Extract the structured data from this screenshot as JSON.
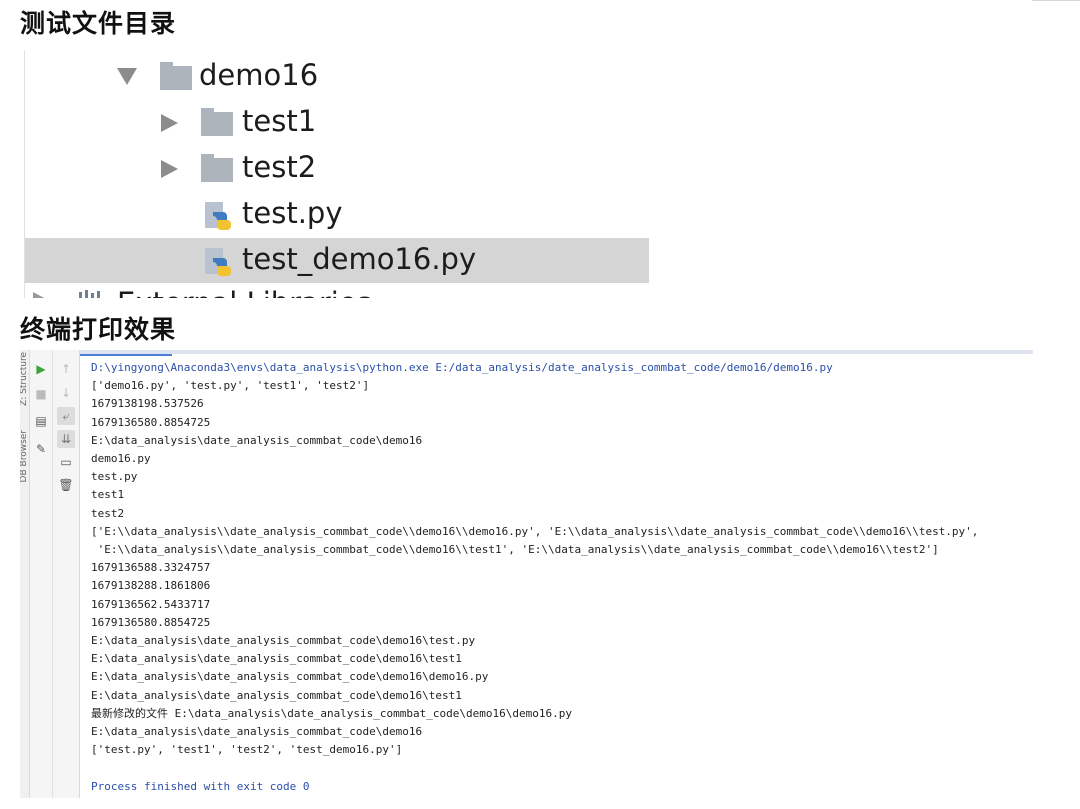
{
  "heading_tree": "测试文件目录",
  "heading_console": "终端打印效果",
  "tree": {
    "items": [
      {
        "label": "demo16",
        "kind": "folder",
        "arrow": "down"
      },
      {
        "label": "test1",
        "kind": "folder",
        "arrow": "right"
      },
      {
        "label": "test2",
        "kind": "folder",
        "arrow": "right"
      },
      {
        "label": "test.py",
        "kind": "python-file",
        "arrow": ""
      },
      {
        "label": "test_demo16.py",
        "kind": "python-file",
        "arrow": "",
        "selected": true
      }
    ],
    "cut_item": "External Libraries"
  },
  "console": {
    "side_tabs": [
      "Z: Structure",
      "DB Browser"
    ],
    "lines": [
      "D:\\yingyong\\Anaconda3\\envs\\data_analysis\\python.exe E:/data_analysis/date_analysis_commbat_code/demo16/demo16.py",
      "['demo16.py', 'test.py', 'test1', 'test2']",
      "1679138198.537526",
      "1679136580.8854725",
      "E:\\data_analysis\\date_analysis_commbat_code\\demo16",
      "demo16.py",
      "test.py",
      "test1",
      "test2",
      "['E:\\\\data_analysis\\\\date_analysis_commbat_code\\\\demo16\\\\demo16.py', 'E:\\\\data_analysis\\\\date_analysis_commbat_code\\\\demo16\\\\test.py',",
      " 'E:\\\\data_analysis\\\\date_analysis_commbat_code\\\\demo16\\\\test1', 'E:\\\\data_analysis\\\\date_analysis_commbat_code\\\\demo16\\\\test2']",
      "1679136588.3324757",
      "1679138288.1861806",
      "1679136562.5433717",
      "1679136580.8854725",
      "E:\\data_analysis\\date_analysis_commbat_code\\demo16\\test.py",
      "E:\\data_analysis\\date_analysis_commbat_code\\demo16\\test1",
      "E:\\data_analysis\\date_analysis_commbat_code\\demo16\\demo16.py",
      "E:\\data_analysis\\date_analysis_commbat_code\\demo16\\test1",
      "最新修改的文件 E:\\data_analysis\\date_analysis_commbat_code\\demo16\\demo16.py",
      "E:\\data_analysis\\date_analysis_commbat_code\\demo16",
      "['test.py', 'test1', 'test2', 'test_demo16.py']",
      "",
      "Process finished with exit code 0"
    ]
  }
}
